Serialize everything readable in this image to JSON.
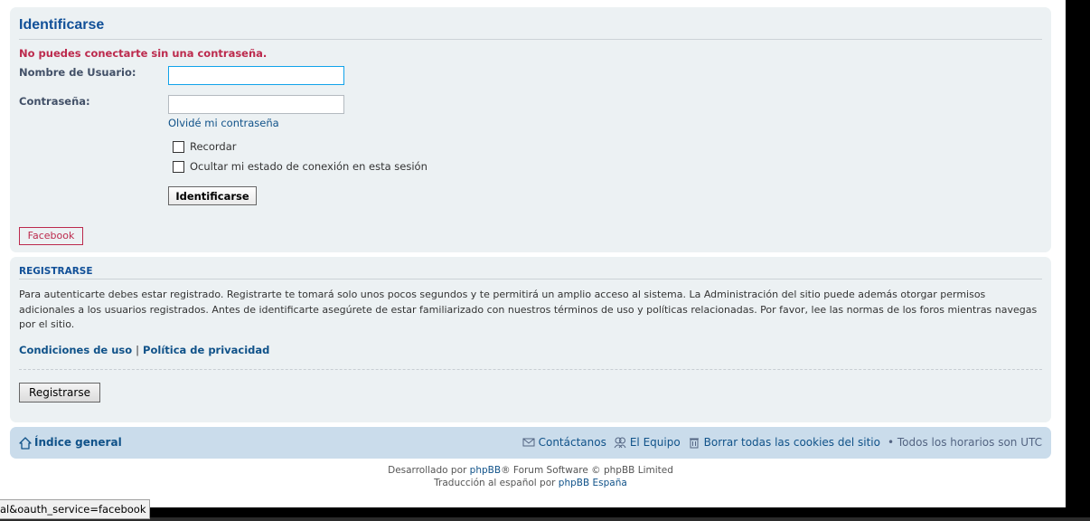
{
  "login": {
    "title": "Identificarse",
    "error": "No puedes conectarte sin una contraseña.",
    "username_label": "Nombre de Usuario:",
    "username_value": "",
    "password_label": "Contraseña:",
    "password_value": "",
    "forgot_link": "Olvidé mi contraseña",
    "remember_label": "Recordar",
    "hide_status_label": "Ocultar mi estado de conexión en esta sesión",
    "submit_label": "Identificarse",
    "facebook_label": "Facebook"
  },
  "register": {
    "title": "REGISTRARSE",
    "text": "Para autenticarte debes estar registrado. Registrarte te tomará solo unos pocos segundos y te permitirá un amplio acceso al sistema. La Administración del sitio puede además otorgar permisos adicionales a los usuarios registrados. Antes de identificarte asegúrete de estar familiarizado con nuestros términos de uso y políticas relacionadas. Por favor, lee las normas de los foros mientras navegas por el sitio.",
    "terms_link": "Condiciones de uso",
    "separator": "|",
    "privacy_link": "Política de privacidad",
    "button_label": "Registrarse"
  },
  "navbar": {
    "home_label": "Índice general",
    "contact_label": "Contáctanos",
    "team_label": "El Equipo",
    "cookies_label": "Borrar todas las cookies del sitio",
    "timezone_label": "• Todos los horarios son UTC"
  },
  "footer": {
    "line1_prefix": "Desarrollado por",
    "line1_link": "phpBB",
    "line1_suffix": "® Forum Software © phpBB Limited",
    "line2_prefix": "Traducción al español por",
    "line2_link": "phpBB España"
  },
  "status_bar": {
    "url": "al&oauth_service=facebook"
  },
  "colors": {
    "panel_bg": "#ECF1F3",
    "navbar_bg": "#CADCEB",
    "link": "#105289",
    "error": "#BC2A4D"
  }
}
